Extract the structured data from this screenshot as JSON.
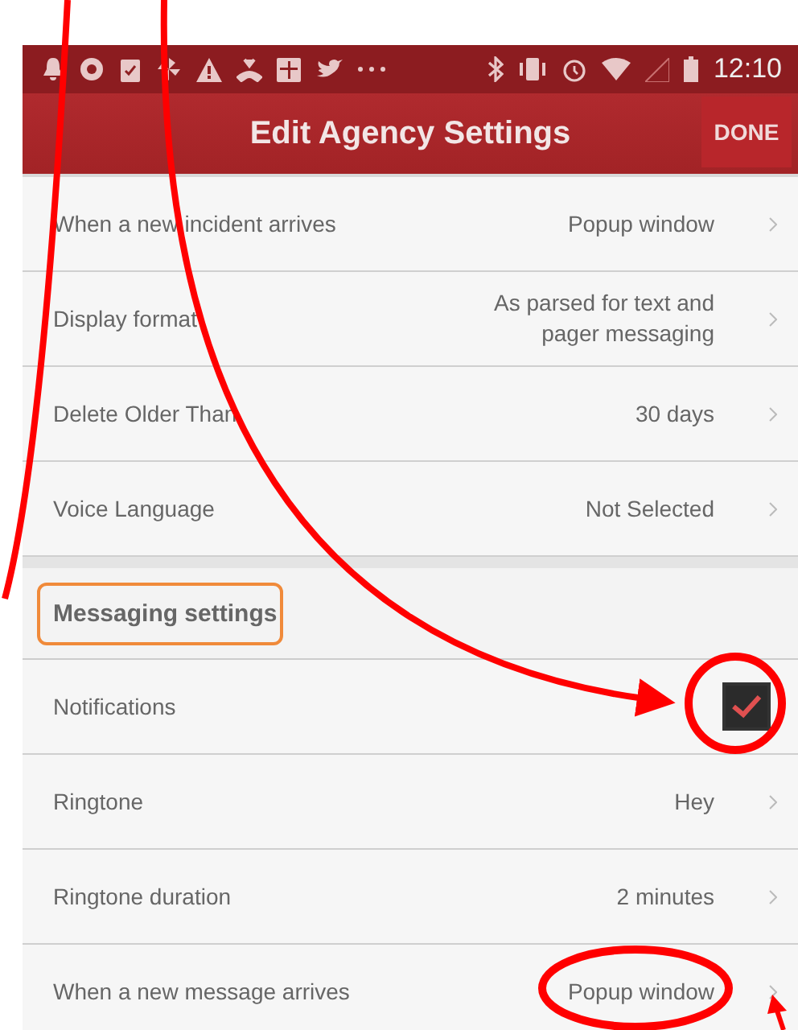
{
  "status_bar": {
    "time": "12:10"
  },
  "app_bar": {
    "title": "Edit Agency Settings",
    "action": "DONE"
  },
  "sections": [
    {
      "rows": [
        {
          "kind": "value",
          "label": "When a new incident arrives",
          "value": "Popup window"
        },
        {
          "kind": "value",
          "label": "Display format",
          "value": "As parsed for text and pager messaging"
        },
        {
          "kind": "value",
          "label": "Delete Older Than",
          "value": "30 days"
        },
        {
          "kind": "value",
          "label": "Voice Language",
          "value": "Not Selected"
        }
      ]
    },
    {
      "header": "Messaging settings",
      "rows": [
        {
          "kind": "checkbox",
          "label": "Notifications",
          "checked": true
        },
        {
          "kind": "value",
          "label": "Ringtone",
          "value": "Hey"
        },
        {
          "kind": "value",
          "label": "Ringtone duration",
          "value": "2 minutes"
        },
        {
          "kind": "value",
          "label": "When a new message arrives",
          "value": "Popup window"
        }
      ]
    }
  ]
}
